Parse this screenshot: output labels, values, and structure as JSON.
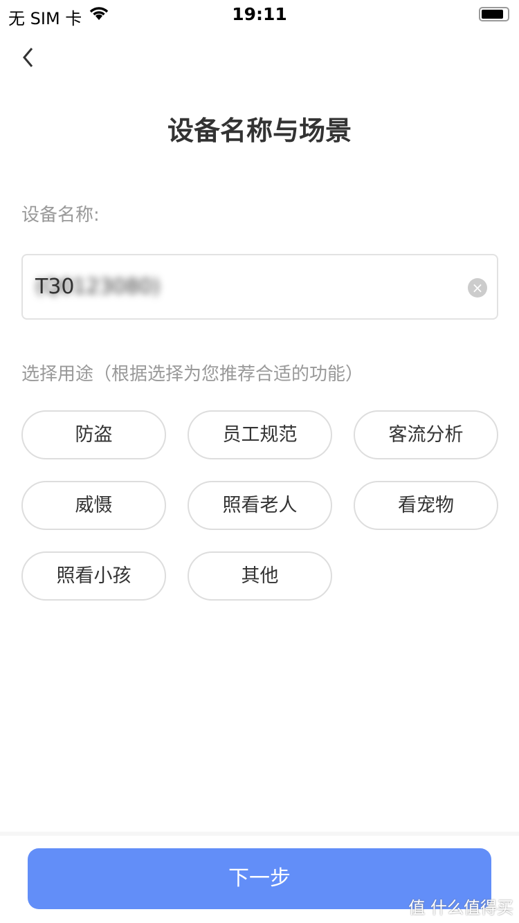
{
  "status_bar": {
    "carrier": "无 SIM 卡",
    "time": "19:11"
  },
  "header": {
    "title": "设备名称与场景"
  },
  "name_field": {
    "label": "设备名称:",
    "value": "T30",
    "blurred_suffix": "(Q0123080)"
  },
  "purpose": {
    "label": "选择用途（根据选择为您推荐合适的功能）",
    "options": [
      "防盗",
      "员工规范",
      "客流分析",
      "威慑",
      "照看老人",
      "看宠物",
      "照看小孩",
      "其他"
    ]
  },
  "footer": {
    "next_label": "下一步",
    "accent": "#628ef8"
  },
  "watermark": "值 什么值得买"
}
